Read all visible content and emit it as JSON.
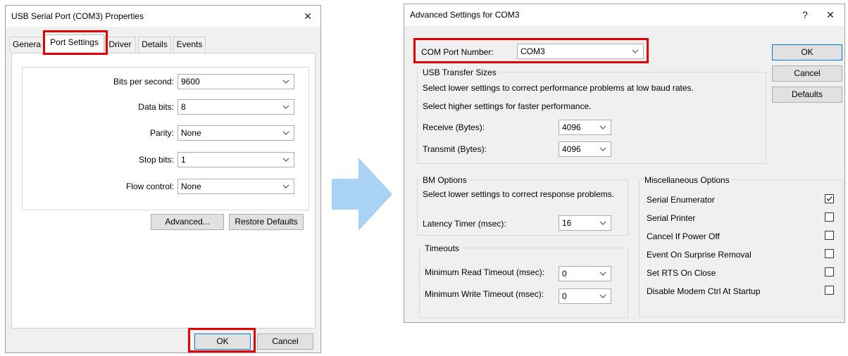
{
  "left_dialog": {
    "title": "USB Serial Port (COM3) Properties",
    "close_label": "✕",
    "tabs": [
      "Genera",
      "Port Settings",
      "Driver",
      "Details",
      "Events"
    ],
    "fields": [
      {
        "label": "Bits per second:",
        "value": "9600"
      },
      {
        "label": "Data bits:",
        "value": "8"
      },
      {
        "label": "Parity:",
        "value": "None"
      },
      {
        "label": "Stop bits:",
        "value": "1"
      },
      {
        "label": "Flow control:",
        "value": "None"
      }
    ],
    "advanced_label": "Advanced...",
    "restore_label": "Restore Defaults",
    "ok_label": "OK",
    "cancel_label": "Cancel"
  },
  "right_dialog": {
    "title": "Advanced Settings for COM3",
    "help_label": "?",
    "close_label": "✕",
    "com_port_label": "COM Port Number:",
    "com_port_value": "COM3",
    "ok_label": "OK",
    "cancel_label": "Cancel",
    "defaults_label": "Defaults",
    "usb": {
      "title": "USB Transfer Sizes",
      "line1": "Select lower settings to correct performance problems at low baud rates.",
      "line2": "Select higher settings for faster performance.",
      "receive_label": "Receive (Bytes):",
      "receive_value": "4096",
      "transmit_label": "Transmit (Bytes):",
      "transmit_value": "4096"
    },
    "bm": {
      "title": "BM Options",
      "line1": "Select lower settings to correct response problems.",
      "latency_label": "Latency Timer (msec):",
      "latency_value": "16"
    },
    "timeouts": {
      "title": "Timeouts",
      "read_label": "Minimum Read Timeout (msec):",
      "read_value": "0",
      "write_label": "Minimum Write Timeout (msec):",
      "write_value": "0"
    },
    "misc": {
      "title": "Miscellaneous Options",
      "options": [
        {
          "label": "Serial Enumerator",
          "checked": true
        },
        {
          "label": "Serial Printer",
          "checked": false
        },
        {
          "label": "Cancel If Power Off",
          "checked": false
        },
        {
          "label": "Event On Surprise Removal",
          "checked": false
        },
        {
          "label": "Set RTS On Close",
          "checked": false
        },
        {
          "label": "Disable Modem Ctrl At Startup",
          "checked": false
        }
      ]
    }
  },
  "colors": {
    "highlight": "#e00000",
    "arrow": "#a9d2f5",
    "focus": "#0078d7"
  }
}
